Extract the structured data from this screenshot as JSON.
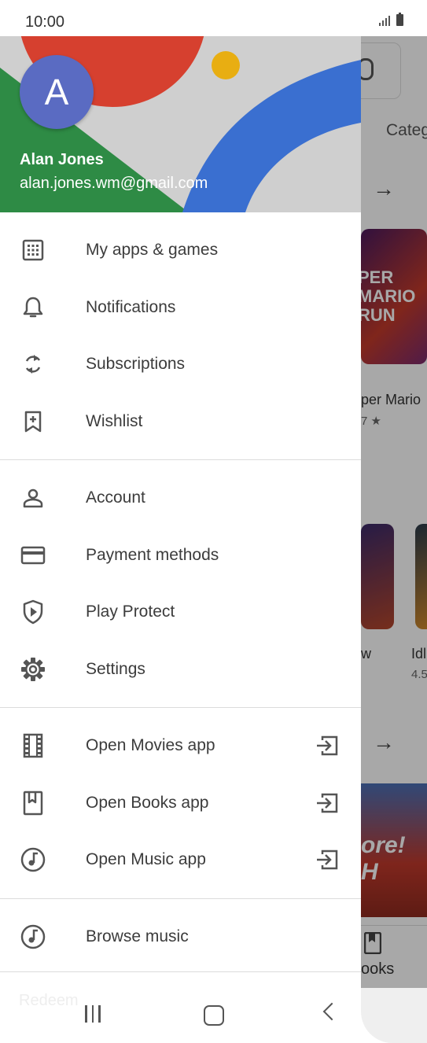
{
  "status_bar": {
    "time": "10:00"
  },
  "background": {
    "tab_label": "Categ",
    "arrow_1": "→",
    "arrow_2": "→",
    "game_title": "per Mario",
    "game_rating": "7 ★",
    "game2_title": "w",
    "game3_title": "Idl",
    "game3_rating": "4.5",
    "books_label": "ooks",
    "card_text_1": "PER MARIO RUN",
    "card_text_2": "ore! H"
  },
  "drawer": {
    "avatar_letter": "A",
    "user_name": "Alan Jones",
    "user_email": "alan.jones.wm@gmail.com",
    "groups": [
      [
        {
          "label": "My apps & games",
          "icon": "apps-grid-icon"
        },
        {
          "label": "Notifications",
          "icon": "bell-icon"
        },
        {
          "label": "Subscriptions",
          "icon": "refresh-icon"
        },
        {
          "label": "Wishlist",
          "icon": "bookmark-add-icon"
        }
      ],
      [
        {
          "label": "Account",
          "icon": "person-icon"
        },
        {
          "label": "Payment methods",
          "icon": "credit-card-icon"
        },
        {
          "label": "Play Protect",
          "icon": "shield-play-icon"
        },
        {
          "label": "Settings",
          "icon": "gear-icon"
        }
      ],
      [
        {
          "label": "Open Movies app",
          "icon": "film-icon",
          "external": true
        },
        {
          "label": "Open Books app",
          "icon": "book-icon",
          "external": true
        },
        {
          "label": "Open Music app",
          "icon": "music-note-icon",
          "external": true
        }
      ],
      [
        {
          "label": "Browse music",
          "icon": "music-note-icon"
        }
      ]
    ],
    "footer_text": "Redeem"
  },
  "colors": {
    "avatar": "#5a6bc2",
    "header_red": "#d6402f",
    "header_blue": "#3a6fd0",
    "header_green": "#2e8b45",
    "header_yellow": "#e8ae12"
  }
}
